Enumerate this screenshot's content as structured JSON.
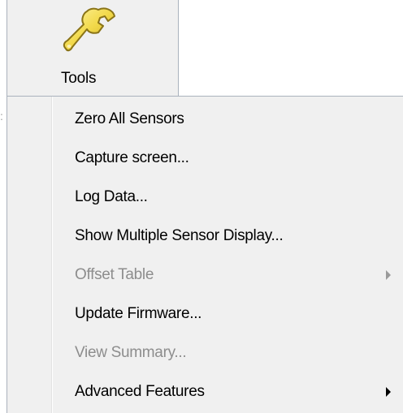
{
  "toolbar": {
    "tools_label": "Tools",
    "tools_icon": "wrench-icon"
  },
  "left_edge": {
    "mark": ":"
  },
  "menu": {
    "items": [
      {
        "label": "Zero All Sensors",
        "enabled": true,
        "has_submenu": false
      },
      {
        "label": "Capture screen...",
        "enabled": true,
        "has_submenu": false
      },
      {
        "label": "Log Data...",
        "enabled": true,
        "has_submenu": false
      },
      {
        "label": "Show Multiple Sensor Display...",
        "enabled": true,
        "has_submenu": false
      },
      {
        "label": "Offset Table",
        "enabled": false,
        "has_submenu": true
      },
      {
        "label": "Update Firmware...",
        "enabled": true,
        "has_submenu": false
      },
      {
        "label": "View Summary...",
        "enabled": false,
        "has_submenu": false
      },
      {
        "label": "Advanced Features",
        "enabled": true,
        "has_submenu": true
      }
    ]
  },
  "colors": {
    "menu_background": "#f0f0f0",
    "border": "#aab2bd",
    "disabled_text": "#8d8d8d",
    "wrench_fill": "#f2d94a",
    "wrench_outline": "#8a7418"
  }
}
